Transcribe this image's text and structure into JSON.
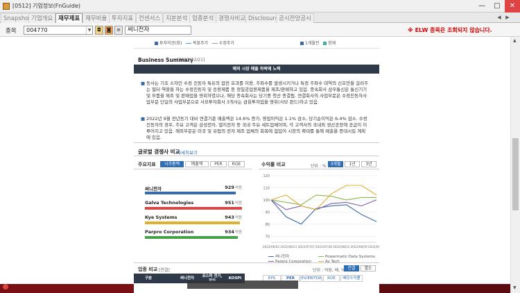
{
  "window": {
    "title": "[0512] 기업정보(FnGuide)",
    "min": "—",
    "max": "□",
    "close": "✕"
  },
  "tabs": [
    "Snapshot",
    "기업개요",
    "재무제표",
    "재무비율",
    "투자지표",
    "컨센서스",
    "지분분석",
    "업종분석",
    "경쟁사비교",
    "Disclosure",
    "공시전망공시"
  ],
  "active_tab": "재무제표",
  "toolbar": {
    "label": "종목",
    "code": "004770",
    "icon1": "◘",
    "icon2": "◙",
    "icon3": "≡",
    "name": "써니전자",
    "notice": "※ ELW 종목은 조회되지 않습니다."
  },
  "legend_top_left": [
    {
      "label": "투자의견(좌)",
      "color": "#3a6aa8"
    },
    {
      "label": "목표주가",
      "color": "#5a8fd0"
    },
    {
      "label": "수정주가",
      "color": "#999999"
    }
  ],
  "legend_top_right": [
    {
      "label": "1개월전",
      "color": "#3a6aa8"
    },
    {
      "label": "현재",
      "color": "#3fb0a0"
    }
  ],
  "business": {
    "title": "Business Summary",
    "date": "[2022/12/21]",
    "banner": "해외 시장 매출 하락에 노력",
    "paragraphs": [
      "동사는 기초 소자인 수정 진동자 특유의 압전 효과를 이용, 주파수를 발생시키거나 특정 주파수 대역의 신호만을 걸러주는 필터 역할을 하는 수정진동자 및 응용제품 등 정밀공업용제품을 제조/판매하고 있음. 종속회사 삼우통신은 통신기기 및 부품을 제조 및 판매업을 영위하였으나, 해당 종속회사는 당기중 청산 종결됨. 연결회사의 사업부문은 수정진동자사업부문 단일의 사업부문으로 사모투자회사 3개사는 금융투자업을 영위(사모 펀드)하고 있음.",
      "2022년 9월 전년동기 대비 연결기준 매출액은 14.6% 증가, 영업이익은 1.1% 감소, 당기순이익은 6.4% 감소. 수정진동자의 경우, 주요 고객은 삼성전자, 엘지전자 등 국내 주요 세트업체이며, 각 고객사의 국내외 생산공장에 공급이 이루어지고 있음. 해외부문은 미국 및 유럽의 전자 제조 업체의 회복에 힘입어 시장의 확대를 통해 매출을 증대시킬 계획에 있음."
    ]
  },
  "global": {
    "title": "글로벌 경쟁사 비교",
    "more": "자세히보기"
  },
  "indicators": {
    "title": "주요지표",
    "tabs": [
      "시가총액",
      "매출액",
      "PER",
      "ROE"
    ],
    "active": "시가총액",
    "companies": [
      {
        "name": "써니전자",
        "value": "929",
        "unit": "억원",
        "color": "#3a6aa8"
      },
      {
        "name": "Galva Technologies",
        "value": "951",
        "unit": "억원",
        "color": "#d84a4a"
      },
      {
        "name": "Kye Systems",
        "value": "943",
        "unit": "억원",
        "color": "#e0b030"
      },
      {
        "name": "Parpro Corporation",
        "value": "934",
        "unit": "억원",
        "color": "#47a04a"
      }
    ]
  },
  "returns": {
    "title": "수익률 비교",
    "unit_label": "단위 : %",
    "tabs": [
      "3개월",
      "1년",
      "3년"
    ],
    "active": "3개월",
    "legend": [
      {
        "name": "써니전자",
        "color": "#3a6aa8"
      },
      {
        "name": "Powermatic Data Systems",
        "color": "#8ab84a"
      },
      {
        "name": "Parpro Corporation",
        "color": "#7a5aa8"
      },
      {
        "name": "Av Tech",
        "color": "#e0b030"
      }
    ]
  },
  "chart_data": {
    "type": "line",
    "title": "수익률 비교",
    "xlabel": "",
    "ylabel": "",
    "x": [
      "2022/06/02",
      "2022/06/21",
      "2022/07/07",
      "2022/07/26",
      "2022/08/12",
      "2022/08/29",
      "2022/09/16",
      "2022/09/30"
    ],
    "x_ticks": [
      "2022/06/02",
      "2022/06/21",
      "2022/07/07",
      "2022/07/26",
      "2022/08/12",
      "2022/08/29",
      "2022/09/30"
    ],
    "ylim": [
      65,
      120
    ],
    "yticks": [
      70,
      80,
      90,
      100,
      110,
      120
    ],
    "series": [
      {
        "name": "써니전자",
        "color": "#3a6aa8",
        "values": [
          100,
          86,
          80,
          93,
          95,
          96,
          88,
          82
        ]
      },
      {
        "name": "Powermatic Data Systems",
        "color": "#8ab84a",
        "values": [
          100,
          98,
          96,
          104,
          103,
          100,
          102,
          102
        ]
      },
      {
        "name": "Parpro Corporation",
        "color": "#7a5aa8",
        "values": [
          100,
          92,
          95,
          92,
          97,
          98,
          95,
          100
        ]
      },
      {
        "name": "Av Tech",
        "color": "#e0b030",
        "values": [
          100,
          104,
          95,
          92,
          105,
          112,
          112,
          104
        ]
      }
    ]
  },
  "industry": {
    "title": "업종 비교",
    "subtitle": "[연결]",
    "unit": "단위 : 억원, 배, %",
    "toggle": [
      "연결",
      "별도"
    ],
    "headers": [
      "구분",
      "써니전자",
      "코스피 전기,전자",
      "KOSPI"
    ],
    "tabs": [
      "EPS",
      "PER",
      "EV/EBITDA",
      "ROE",
      "배당수익률"
    ],
    "active_tab": "PER"
  }
}
